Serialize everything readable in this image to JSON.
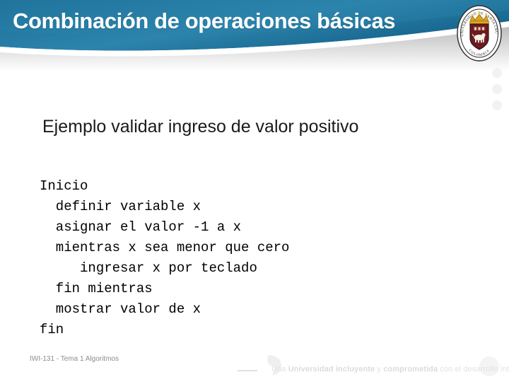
{
  "header": {
    "title": "Combinación de operaciones básicas",
    "band_color_dark": "#125d83",
    "band_color_light": "#2a80a8",
    "title_color": "#ffffff",
    "seal_icon": "university-crest-icon",
    "seal_outer_text": "UNIVERSIDAD DE SANTA CRUZ",
    "seal_bottom_text": "COLOMBIA"
  },
  "decor": {
    "dot_color": "#f2f2f2",
    "dots": [
      "dot-1",
      "dot-2",
      "dot-3"
    ]
  },
  "body": {
    "subtitle": "Ejemplo validar ingreso de valor positivo",
    "code_lines": [
      "Inicio",
      "  definir variable x",
      "  asignar el valor -1 a x",
      "  mientras x sea menor que cero",
      "     ingresar x por teclado",
      "  fin mientras",
      "  mostrar valor de x",
      "fin"
    ],
    "code_text": "Inicio\n  definir variable x\n  asignar el valor -1 a x\n  mientras x sea menor que cero\n     ingresar x por teclado\n  fin mientras\n  mostrar valor de x\nfin"
  },
  "footer": {
    "course_note": "IWI-131 - Tema 1 Algoritmos",
    "tagline_prefix": "Una ",
    "tagline_bold_1": "Universidad incluyente",
    "tagline_mid": " y ",
    "tagline_bold_2": "comprometida",
    "tagline_suffix": " con el desarrollo integral",
    "tagline_full": "Una Universidad incluyente y comprometida con el desarrollo integral",
    "quote_icon": "quote-mark-icon",
    "dash_icon": "dash-rule-icon",
    "note_color": "#8c8c8c"
  }
}
